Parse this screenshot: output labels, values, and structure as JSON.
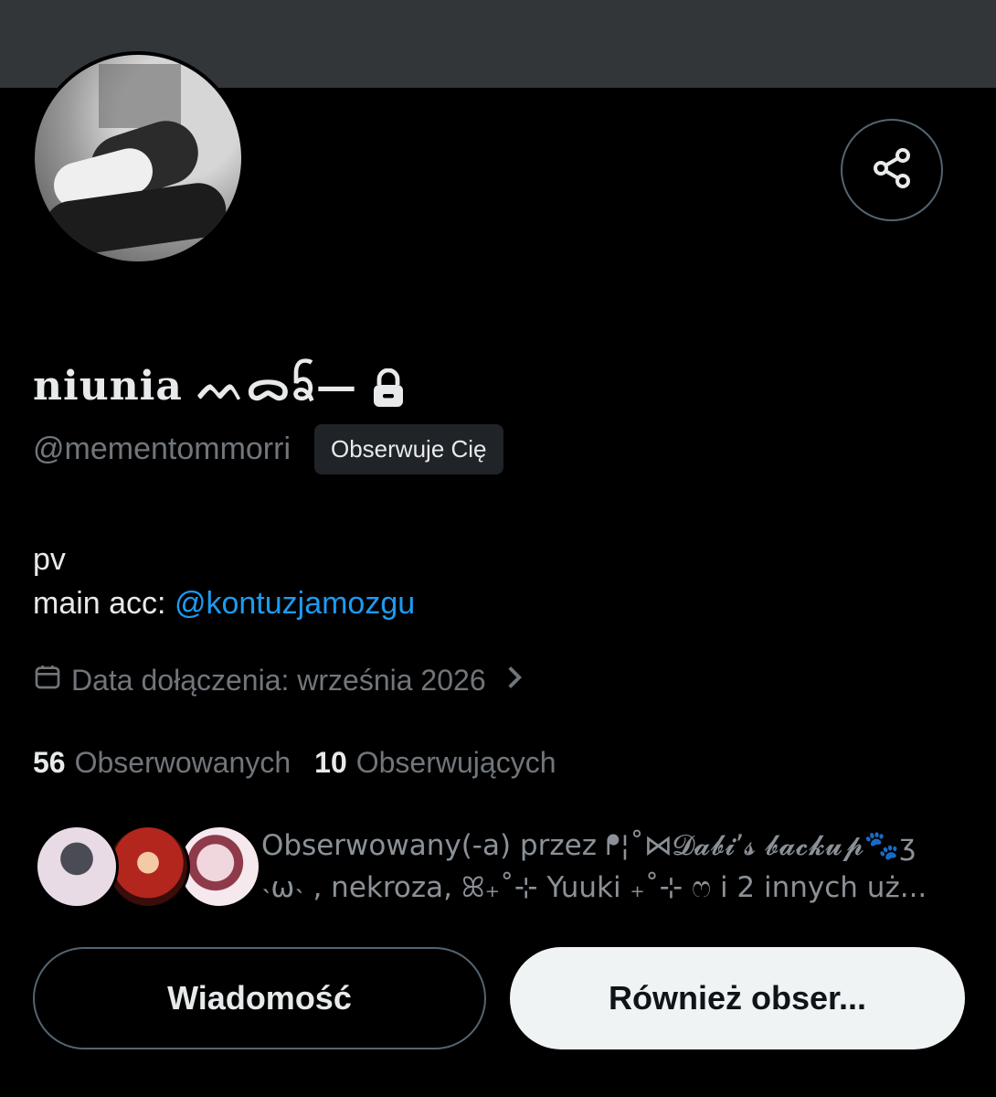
{
  "profile": {
    "display_name": "niunia ᨓᯅᨢ—",
    "handle": "@mementommorri",
    "follows_you_badge": "Obserwuje Cię",
    "bio_line1": "pv",
    "bio_prefix": "main acc: ",
    "bio_mention": "@kontuzjamozgu",
    "joined": "Data dołączenia: września 2026",
    "following_count": "56",
    "following_label": "Obserwowanych",
    "followers_count": "10",
    "followers_label": "Obserwujących",
    "followed_by_line1": "Obserwowany(-a) przez ᖰ¦˚⋈𝓓𝓪𝓫𝓲’𝓼 𝓫𝓪𝓬𝓴𝓾𝓹🐾ʒ",
    "followed_by_line2": "˴ω˴ , nekroza, ꕤ₊˚⊹ Yuuki ₊˚⊹ ෆ i 2 innych uż..."
  },
  "actions": {
    "message": "Wiadomość",
    "follow_back": "Również obser..."
  },
  "icons": {
    "share": "share-icon",
    "lock": "lock-icon",
    "calendar": "calendar-icon",
    "chevron": "chevron-right-icon"
  },
  "colors": {
    "background": "#000000",
    "banner": "#333639",
    "link": "#1d9bf0",
    "muted": "#71767b",
    "primary_button": "#eff3f4"
  }
}
